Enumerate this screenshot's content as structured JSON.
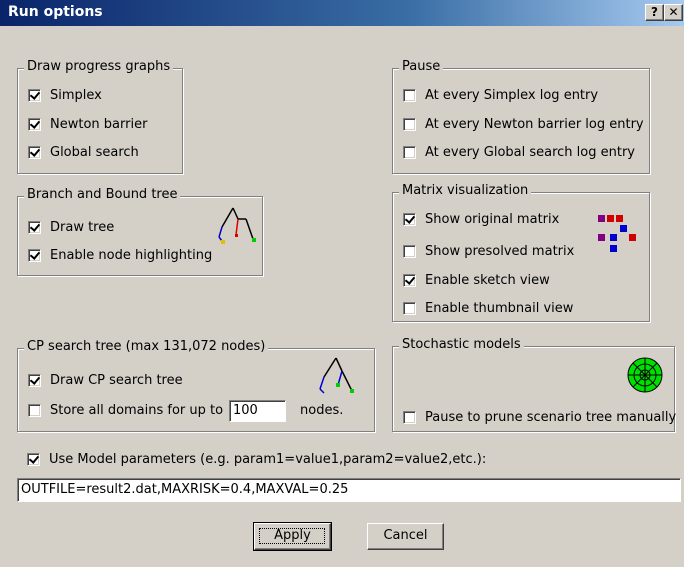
{
  "window": {
    "title": "Run options",
    "help_label": "?",
    "close_label": "✕"
  },
  "draw_progress": {
    "legend": "Draw progress graphs",
    "items": [
      {
        "label": "Simplex",
        "checked": true
      },
      {
        "label": "Newton barrier",
        "checked": true
      },
      {
        "label": "Global search",
        "checked": true
      }
    ]
  },
  "pause": {
    "legend": "Pause",
    "items": [
      {
        "label": "At every Simplex log entry",
        "checked": false
      },
      {
        "label": "At every Newton barrier log entry",
        "checked": false
      },
      {
        "label": "At every Global search log entry",
        "checked": false
      }
    ]
  },
  "bb_tree": {
    "legend": "Branch and Bound tree",
    "items": [
      {
        "label": "Draw tree",
        "checked": true
      },
      {
        "label": "Enable node highlighting",
        "checked": true
      }
    ]
  },
  "matrix": {
    "legend": "Matrix visualization",
    "items": [
      {
        "label": "Show original matrix",
        "checked": true
      },
      {
        "label": "Show presolved matrix",
        "checked": false
      },
      {
        "label": "Enable sketch view",
        "checked": true
      },
      {
        "label": "Enable thumbnail view",
        "checked": false
      }
    ]
  },
  "cp_tree": {
    "legend": "CP search tree (max 131,072 nodes)",
    "draw_label": "Draw CP search tree",
    "draw_checked": true,
    "store_label": "Store all domains for up to",
    "store_checked": false,
    "store_value": "100",
    "store_suffix": "nodes."
  },
  "stochastic": {
    "legend": "Stochastic models",
    "prune_label": "Pause to prune scenario tree manually",
    "prune_checked": false
  },
  "model_params": {
    "label": "Use Model parameters (e.g. param1=value1,param2=value2,etc.):",
    "checked": true,
    "value": "OUTFILE=result2.dat,MAXRISK=0.4,MAXVAL=0.25"
  },
  "buttons": {
    "apply": "Apply",
    "cancel": "Cancel"
  },
  "icons": {
    "tree": "tree-icon",
    "matrix": "matrix-icon",
    "cp_tree": "cp-tree-icon",
    "scenario": "scenario-tree-icon"
  }
}
